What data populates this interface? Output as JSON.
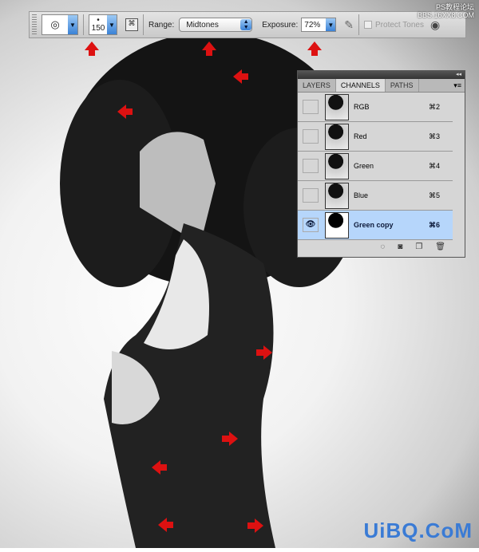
{
  "toolbar": {
    "brush_size": "150",
    "range_label": "Range:",
    "range_value": "Midtones",
    "exposure_label": "Exposure:",
    "exposure_value": "72%",
    "protect_tones": "Protect Tones",
    "protect_checked": false
  },
  "panel": {
    "tabs": [
      "LAYERS",
      "CHANNELS",
      "PATHS"
    ],
    "active_tab": "CHANNELS",
    "collapse": "◂◂",
    "channels": [
      {
        "name": "RGB",
        "shortcut": "⌘2",
        "visible": false
      },
      {
        "name": "Red",
        "shortcut": "⌘3",
        "visible": false
      },
      {
        "name": "Green",
        "shortcut": "⌘4",
        "visible": false
      },
      {
        "name": "Blue",
        "shortcut": "⌘5",
        "visible": false
      },
      {
        "name": "Green copy",
        "shortcut": "⌘6",
        "visible": true,
        "selected": true
      }
    ]
  },
  "watermark": {
    "top_line1": "PS教程论坛",
    "top_line2": "BBS.16XX8.COM",
    "bottom": "UiBQ.CoM"
  },
  "colors": {
    "arrow": "#dd1111",
    "selection": "#b6d6fb"
  }
}
